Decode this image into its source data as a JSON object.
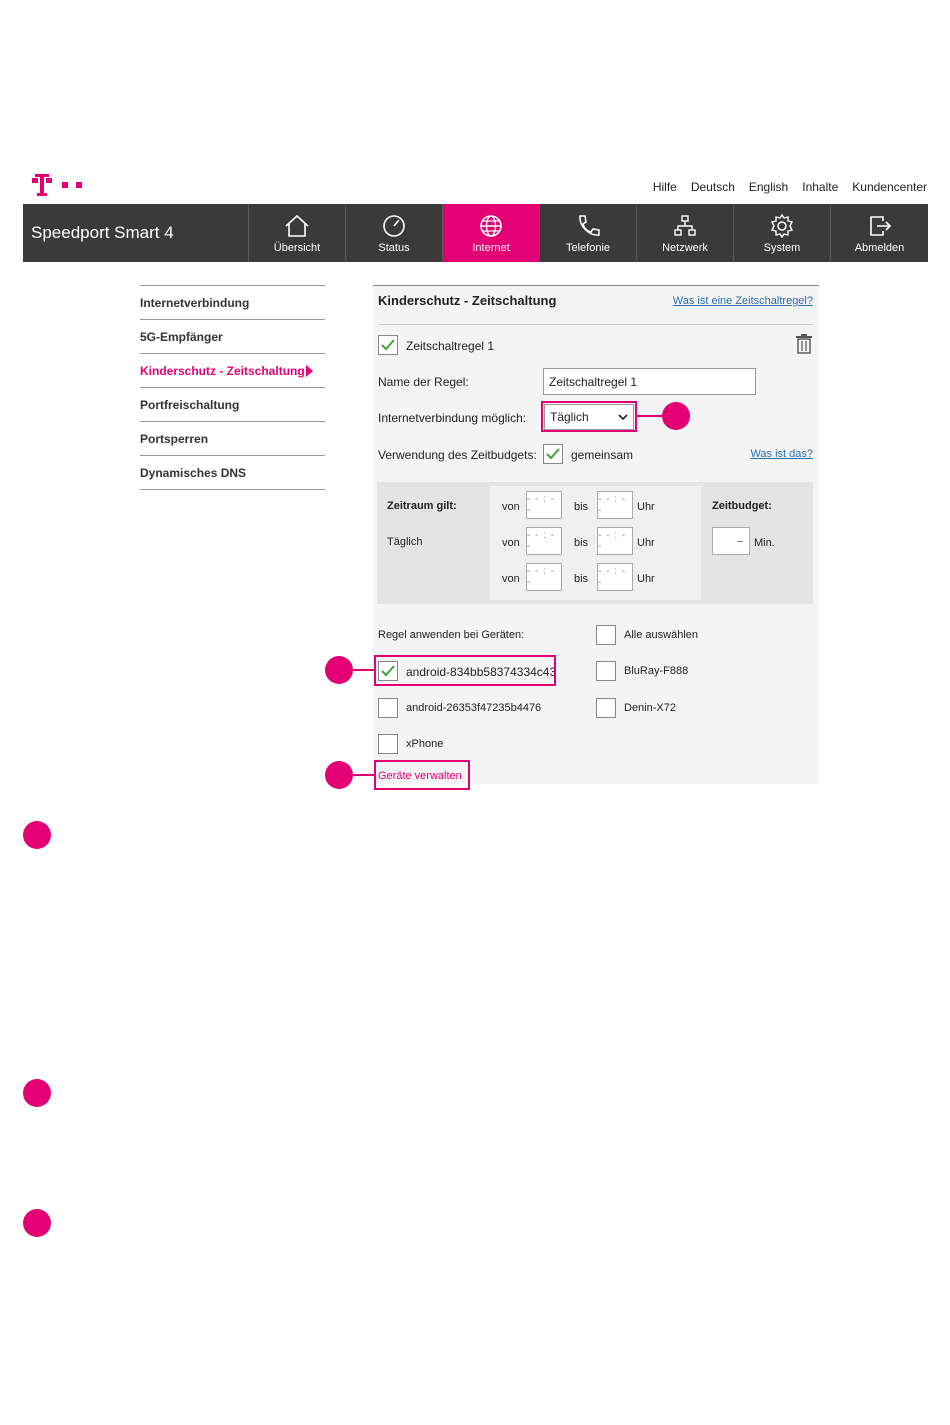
{
  "header": {
    "links": [
      "Hilfe",
      "Deutsch",
      "English",
      "Inhalte",
      "Kundencenter"
    ]
  },
  "navbar": {
    "brand": "Speedport Smart 4",
    "items": [
      {
        "label": "Übersicht",
        "icon": "home-icon"
      },
      {
        "label": "Status",
        "icon": "gauge-icon"
      },
      {
        "label": "Internet",
        "icon": "globe-icon",
        "active": true
      },
      {
        "label": "Telefonie",
        "icon": "phone-icon"
      },
      {
        "label": "Netzwerk",
        "icon": "network-icon"
      },
      {
        "label": "System",
        "icon": "gear-icon"
      },
      {
        "label": "Abmelden",
        "icon": "logout-icon"
      }
    ]
  },
  "sidebar": {
    "items": [
      {
        "label": "Internetverbindung"
      },
      {
        "label": "5G-Empfänger"
      },
      {
        "label": "Kinderschutz - Zeitschaltung",
        "active": true
      },
      {
        "label": "Portfreischaltung"
      },
      {
        "label": "Portsperren"
      },
      {
        "label": "Dynamisches DNS"
      }
    ]
  },
  "panel": {
    "title": "Kinderschutz - Zeitschaltung",
    "help_link": "Was ist eine Zeitschaltregel?",
    "rule_label": "Zeitschaltregel 1",
    "rule_checked": true,
    "name_label": "Name der Regel:",
    "name_value": "Zeitschaltregel 1",
    "connection_label": "Internetverbindung möglich:",
    "connection_value": "Täglich",
    "budget_label": "Verwendung des Zeitbudgets:",
    "budget_option": "gemeinsam",
    "budget_checked": true,
    "budget_help": "Was ist das?",
    "schedule": {
      "period_label": "Zeitraum gilt:",
      "period_value": "Täglich",
      "from_label": "von",
      "to_label": "bis",
      "unit_label": "Uhr",
      "time_placeholder": "- - : - -",
      "budget_title": "Zeitbudget:",
      "budget_value": "–",
      "budget_unit": "Min."
    },
    "devices_label": "Regel anwenden bei Geräten:",
    "select_all": "Alle auswählen",
    "devices": [
      {
        "name": "android-834bb58374334c43",
        "checked": true
      },
      {
        "name": "BluRay-F888",
        "checked": false
      },
      {
        "name": "android-26353f47235b4476",
        "checked": false
      },
      {
        "name": "Denin-X72",
        "checked": false
      },
      {
        "name": "xPhone",
        "checked": false
      }
    ],
    "manage_link": "Geräte verwalten"
  },
  "colors": {
    "brand": "#e20074",
    "navbar": "#3a3a3a",
    "check": "#3aa53a",
    "link": "#2a6db0"
  }
}
